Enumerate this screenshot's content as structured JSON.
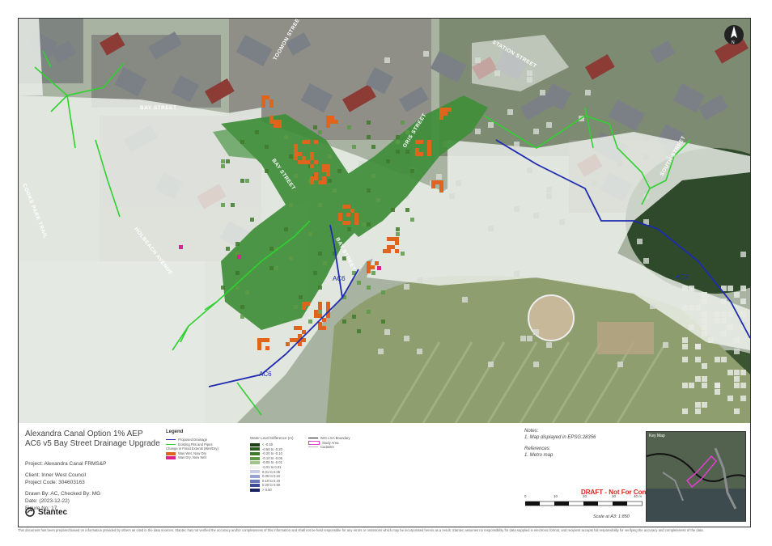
{
  "map": {
    "street_labels": {
      "bay_street_north": "BAY STREET",
      "bay_street_diag": "BAY STREET",
      "bay_street_lower": "BAY STREET",
      "holbeach_avenue": "HOLBEACH AVENUE",
      "cooks_park_trail": "COOKS PARK TRAIL",
      "oris_street": "ORIS STREET",
      "south_street": "SOUTH STREET",
      "top_street_left": "TOOMON STREET",
      "top_street_right": "STATION STREET"
    },
    "drainage_labels": {
      "ac6_upper": "AC6",
      "ac6_lower": "AC6",
      "ac4": "AC4"
    },
    "north_arrow": "N",
    "colors": {
      "aerial_base": "#a8b3a2",
      "park_grass": "#8e9e6e",
      "tree_canopy": "#2f4a2a",
      "overlay_white": "#eef2ec",
      "flood_green": "#3f8e3a",
      "flood_orange": "#e0651c",
      "flood_pink": "#e0208c",
      "drainage_blue": "#1f2bb0",
      "pipe_green": "#2fd12f",
      "roof_gray": "#7b7f86",
      "roof_red": "#8c3b35"
    }
  },
  "title_block": {
    "title_line1": "Alexandra Canal Option 1% AEP",
    "title_line2": "AC6 v5 Bay Street Drainage Upgrade",
    "project": "Project: Alexandra Canal FRMS&P",
    "client": "Client:  Inner West Council",
    "project_code": "Project Code:  304603163",
    "drawn_by": "Drawn By:  AC, Checked By: MG",
    "date": "Date:  (2023-12-22)",
    "figure_no": "Figure No:  17",
    "company": "Stantec",
    "legend": {
      "title": "Legend",
      "items": [
        {
          "label": "Proposed Drainage",
          "color": "#1f2bb0",
          "kind": "line"
        },
        {
          "label": "Existing Pits and Pipes",
          "color": "#2fd12f",
          "kind": "line"
        },
        {
          "label": "Change in Flood Extents (Wet/Dry)",
          "color": "",
          "kind": "text"
        },
        {
          "label": "Was Wet, Now Dry",
          "color": "#e0651c",
          "kind": "swatch"
        },
        {
          "label": "Was Dry, Now Wet",
          "color": "#e0208c",
          "kind": "swatch"
        }
      ],
      "water_level_title": "Water Level Difference (m)",
      "water_level_items": [
        {
          "label": "< -0.50",
          "color": "#1d3d14"
        },
        {
          "label": "-0.50 to -0.20",
          "color": "#2a5a1e"
        },
        {
          "label": "-0.20 to -0.10",
          "color": "#3f7a2c"
        },
        {
          "label": "-0.10 to -0.05",
          "color": "#5c9a46"
        },
        {
          "label": "-0.05 to -0.01",
          "color": "#9fc58c"
        },
        {
          "label": "-0.01 to 0.01",
          "color": "#f4f4f4"
        },
        {
          "label": "0.01 to 0.05",
          "color": "#c7cde6"
        },
        {
          "label": "0.05 to 0.10",
          "color": "#98a3d1"
        },
        {
          "label": "0.10 to 0.20",
          "color": "#6a78b8"
        },
        {
          "label": "0.20 to 0.50",
          "color": "#3b4b97"
        },
        {
          "label": "> 0.50",
          "color": "#1b2463"
        }
      ],
      "boundary_items": [
        {
          "label": "IWC LGA Boundary",
          "color": "#111111",
          "kind": "line"
        },
        {
          "label": "Study Area",
          "color": "#e040d0",
          "kind": "box"
        },
        {
          "label": "Cadastre",
          "color": "#bbbbbb",
          "kind": "line"
        }
      ]
    },
    "notes_title": "Notes:",
    "notes": "1. Map displayed in EPSG:28356",
    "references_title": "References:",
    "references": "1. Metro map",
    "draft": "DRAFT - Not For Construction",
    "scale_ticks": [
      "0",
      "10",
      "20",
      "30",
      "40 m"
    ],
    "scale_text": "Scale at A3: 1:850",
    "keymap_label": "Key Map",
    "disclaimer": "This document has been prepared based on information provided by others as cited in the data sources. Stantec has not verified the accuracy and/or completeness of this information and shall not be held responsible for any errors or omissions which may be incorporated herein as a result. Stantec assumes no responsibility for data supplied in electronic format, and recipient accepts full responsibility for verifying the accuracy and completeness of the data."
  }
}
